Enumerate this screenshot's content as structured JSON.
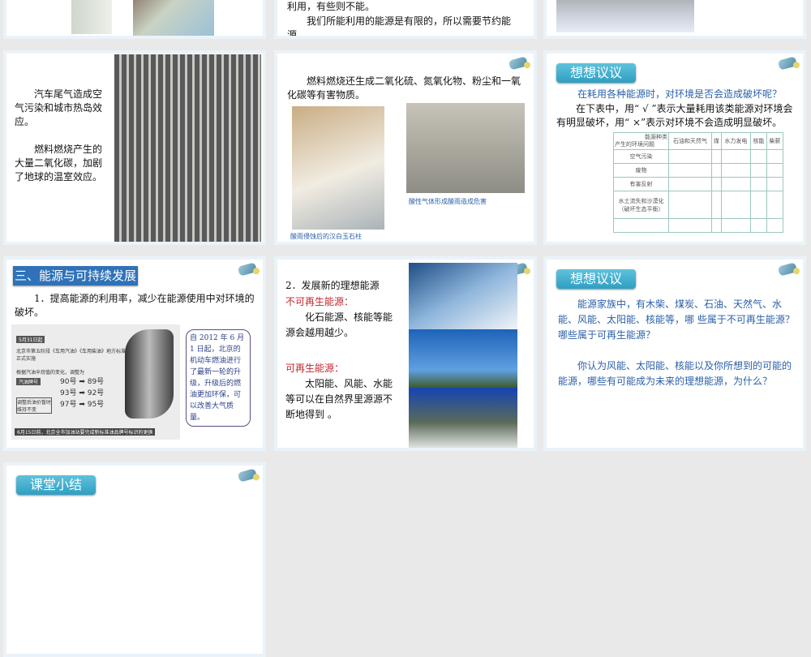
{
  "slides_top": {
    "mid_text1": "利用，有些则不能。",
    "mid_text2": "我们所能利用的能源是有限的，所以需要节约能源。"
  },
  "slide_car": {
    "p1": "汽车尾气造成空气污染和城市热岛效应。",
    "p2": "燃料燃烧产生的大量二氧化碳，加剧了地球的温室效应。"
  },
  "slide_fuel": {
    "p1": "燃料燃烧还生成二氧化硫、氮氧化物、粉尘和一氧化碳等有害物质。",
    "cap1": "酸雨侵蚀后的汉白玉石柱",
    "cap2": "酸性气体形成酸雨造成危害"
  },
  "slide_think1": {
    "badge": "想想议议",
    "q": "在耗用各种能源时，对环境是否会造成破坏呢？",
    "p": "在下表中，用“ √ ”表示大量耗用该类能源对环境会有明显破坏，用“ ×”表示对环境不会造成明显破坏。",
    "corner_top": "能源种类",
    "corner_bottom": "产生的环境问题",
    "cols": [
      "石油和天然气",
      "煤",
      "水力发电",
      "核能",
      "柴薪"
    ],
    "rows": [
      "空气污染",
      "废物",
      "有害反射",
      "水土流失和沙漠化（破坏生态平衡）",
      ""
    ]
  },
  "slide_sustain": {
    "badge": "三、能源与可持续发展",
    "p": "1．提高能源的利用率，减少在能源使用中对环境的破坏。",
    "note": "自 2012 年 6 月 1 日起，北京的机动车燃油进行了最新一轮的升级，升级后的燃油更加环保，可以改善大气质量。",
    "img_date": "5月31日起",
    "img_head": "北京市第五阶段《车用汽油》《车用柴油》地方标准正式实施",
    "img_sub": "根据汽油辛烷值的变化，调整为",
    "img_label1": "汽油牌号",
    "img_label2": "调整后油价暂时维持不变",
    "grades": [
      [
        "90号",
        "89号"
      ],
      [
        "93号",
        "92号"
      ],
      [
        "97号",
        "95号"
      ]
    ],
    "img_foot": "6月15日前，北京全市加油站要完成新标准油品牌号标识的更换"
  },
  "slide_ideal": {
    "title": "2．发展新的理想能源",
    "nr_label": "不可再生能源：",
    "nr_text": "化石能源、核能等能源会越用越少。",
    "r_label": "可再生能源：",
    "r_text": "太阳能、风能、水能等可以在自然界里源源不断地得到 。"
  },
  "slide_think2": {
    "badge": "想想议议",
    "p1": "能源家族中，有木柴、煤炭、石油、天然气、水能、风能、太阳能、核能等，哪 些属于不可再生能源？哪些属于可再生能源？",
    "p2": "你认为风能、太阳能、核能以及你所想到的可能的能源，哪些有可能成为未来的理想能源，为什么？"
  },
  "slide_summary": {
    "badge": "课堂小结"
  }
}
